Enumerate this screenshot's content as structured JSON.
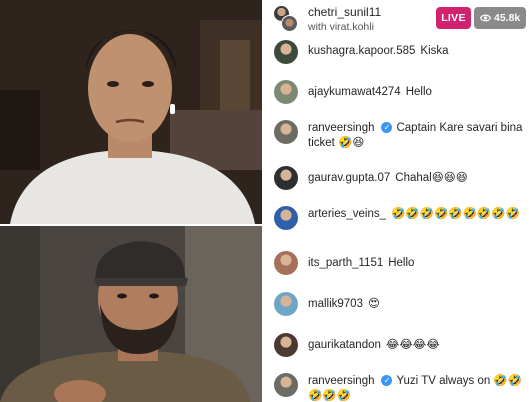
{
  "header": {
    "host_username": "chetri_sunil11",
    "guest_line": "with virat.kohli",
    "live_label": "LIVE",
    "viewer_count": "45.8k"
  },
  "comments": [
    {
      "username": "kushagra.kapoor.585",
      "verified": false,
      "message": "Kiska",
      "avatar_color": "#3c4a3a"
    },
    {
      "username": "ajaykumawat4274",
      "verified": false,
      "message": "Hello",
      "avatar_color": "#7d8a73"
    },
    {
      "username": "ranveersingh",
      "verified": true,
      "message": "Captain Kare savari bina ticket 🤣😆",
      "avatar_color": "#6e6a64"
    },
    {
      "username": "gaurav.gupta.07",
      "verified": false,
      "message": "Chahal😆😆😆",
      "avatar_color": "#2f2f33"
    },
    {
      "username": "arteries_veins_",
      "verified": false,
      "message": "🤣🤣🤣🤣🤣🤣🤣🤣🤣",
      "avatar_color": "#2e5fa8"
    },
    {
      "username": "its_parth_1151",
      "verified": false,
      "message": "Hello",
      "avatar_color": "#a7705a"
    },
    {
      "username": "mallik9703",
      "verified": false,
      "message": "😍",
      "avatar_color": "#6ea6c8"
    },
    {
      "username": "gaurikatandon",
      "verified": false,
      "message": "😂😂😂😂",
      "avatar_color": "#4a3a32"
    },
    {
      "username": "ranveersingh",
      "verified": true,
      "message": "Yuzi TV always on 🤣🤣🤣🤣🤣",
      "avatar_color": "#6e6a64"
    }
  ]
}
